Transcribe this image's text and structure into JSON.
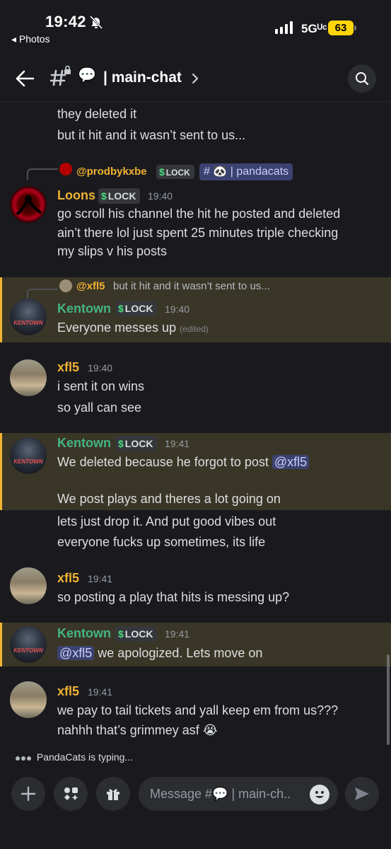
{
  "status_bar": {
    "time": "19:42",
    "back_app": "◂ Photos",
    "network": "5Gᵁᶜ",
    "battery": "63"
  },
  "header": {
    "channel_emoji": "💬",
    "channel_name": "| main-chat"
  },
  "messages": [
    {
      "id": "cont-1",
      "lines": [
        "they deleted it",
        "but it hit and it wasn’t sent to us..."
      ]
    },
    {
      "id": "loons",
      "reply_to": {
        "name": "@prodbykxbe",
        "badge": "LOCK",
        "channel_mention": "# 🐼 | pandacats"
      },
      "author": "Loons",
      "badge": "LOCK",
      "time": "19:40",
      "lines": [
        "go scroll his channel the hit he posted and deleted",
        "ain’t there lol just spent 25 minutes triple checking",
        "my slips v his posts"
      ]
    },
    {
      "id": "kentown-1",
      "reply_to": {
        "name": "@xfl5",
        "text": "but it hit and it wasn’t sent to us..."
      },
      "author": "Kentown",
      "badge": "LOCK",
      "time": "19:40",
      "lines": [
        "Everyone messes up"
      ],
      "edited": "(edited)"
    },
    {
      "id": "xfl5-1",
      "author": "xfl5",
      "time": "19:40",
      "lines": [
        "i sent it on wins",
        "so yall can see"
      ]
    },
    {
      "id": "kentown-2",
      "author": "Kentown",
      "badge": "LOCK",
      "time": "19:41",
      "lines": [
        "We deleted because he forgot to post",
        "",
        "We post plays and theres a lot going on",
        "lets just drop it. And put good vibes out",
        "everyone fucks up sometimes, its life"
      ],
      "mention": "@xfl5"
    },
    {
      "id": "xfl5-2",
      "author": "xfl5",
      "time": "19:41",
      "lines": [
        "so posting a play that hits is messing up?"
      ]
    },
    {
      "id": "kentown-3",
      "author": "Kentown",
      "badge": "LOCK",
      "time": "19:41",
      "mention": "@xfl5",
      "lines": [
        " we apologized. Lets move on"
      ]
    },
    {
      "id": "xfl5-3",
      "author": "xfl5",
      "time": "19:41",
      "lines": [
        "we pay to tail tickets and yall keep em from us???",
        "nahhh that’s grimmey asf 😭"
      ]
    }
  ],
  "typing_indicator": "PandaCats is typing...",
  "avatar_text": {
    "kentown": "KENTOWN"
  },
  "composer": {
    "placeholder": "Message #💬 | main-ch.."
  },
  "colors": {
    "background": "#1a1a1e",
    "highlight": "#3a3627",
    "highlight_bar": "#f0b232",
    "name_gold": "#f0b232",
    "name_green": "#43b581",
    "mention_bg": "#3c4270"
  }
}
